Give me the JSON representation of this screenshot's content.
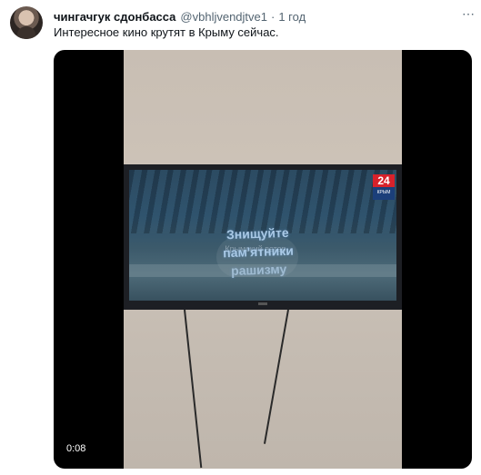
{
  "tweet": {
    "author": {
      "display_name": "чингачгук сдонбасса",
      "handle": "@vbhljvendjtve1",
      "separator": "·",
      "time": "1 год"
    },
    "more_icon": "ellipsis-icon",
    "text": "Интересное кино крутят в Крыму сейчас.",
    "video": {
      "duration": "0:08",
      "caption": "Знищуйте пам'ятники рашизму",
      "channel_number": "24",
      "channel_name": "КРЫМ",
      "watermark": "Крымский ветер"
    }
  }
}
